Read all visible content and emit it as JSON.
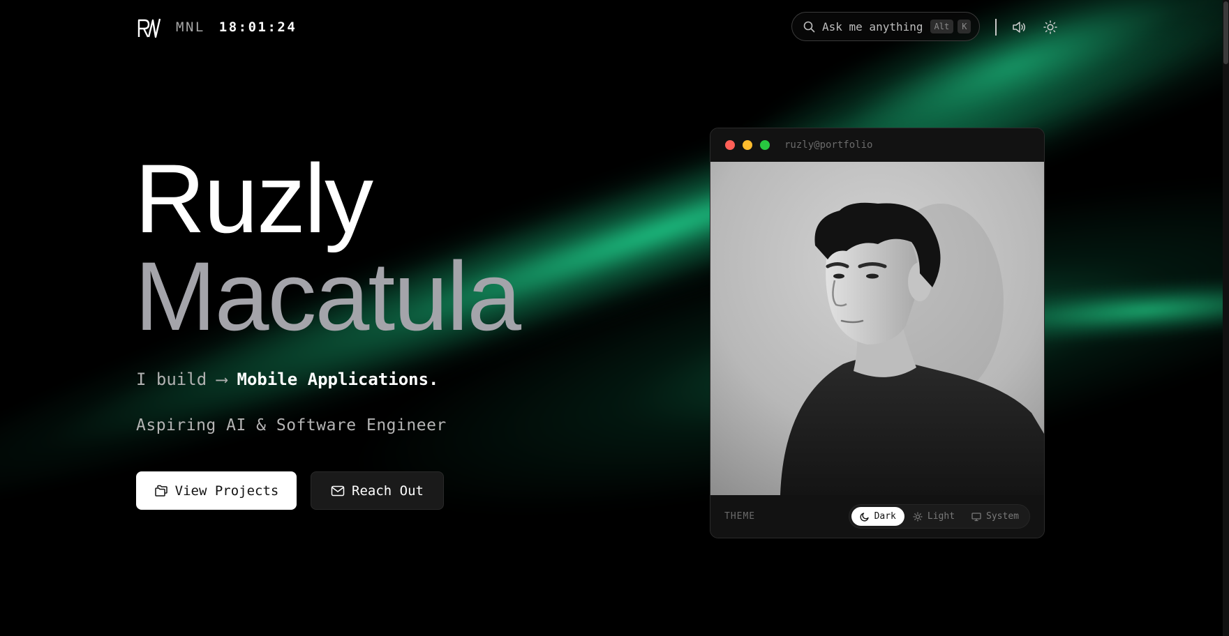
{
  "header": {
    "logo_text": "RM",
    "city": "MNL",
    "time": "18:01:24",
    "search_placeholder": "Ask me anything",
    "shortcut_keys": [
      "Alt",
      "K"
    ],
    "icons": [
      "search-icon",
      "volume-icon",
      "sun-icon"
    ]
  },
  "hero": {
    "first_name": "Ruzly",
    "last_name": "Macatula",
    "tagline_prefix": "I build ⟶",
    "tagline_highlight": "Mobile Applications.",
    "subtitle": "Aspiring AI & Software Engineer",
    "primary_button": "View Projects",
    "secondary_button": "Reach Out"
  },
  "window": {
    "title": "ruzly@portfolio",
    "theme_label": "THEME",
    "theme_options": [
      "Dark",
      "Light",
      "System"
    ],
    "selected_theme": "Dark"
  },
  "colors": {
    "background": "#000000",
    "accent": "#1ec887",
    "muted_name": "#a4a4aa",
    "dot_red": "#ff5f57",
    "dot_yellow": "#febc2e",
    "dot_green": "#28c840"
  }
}
